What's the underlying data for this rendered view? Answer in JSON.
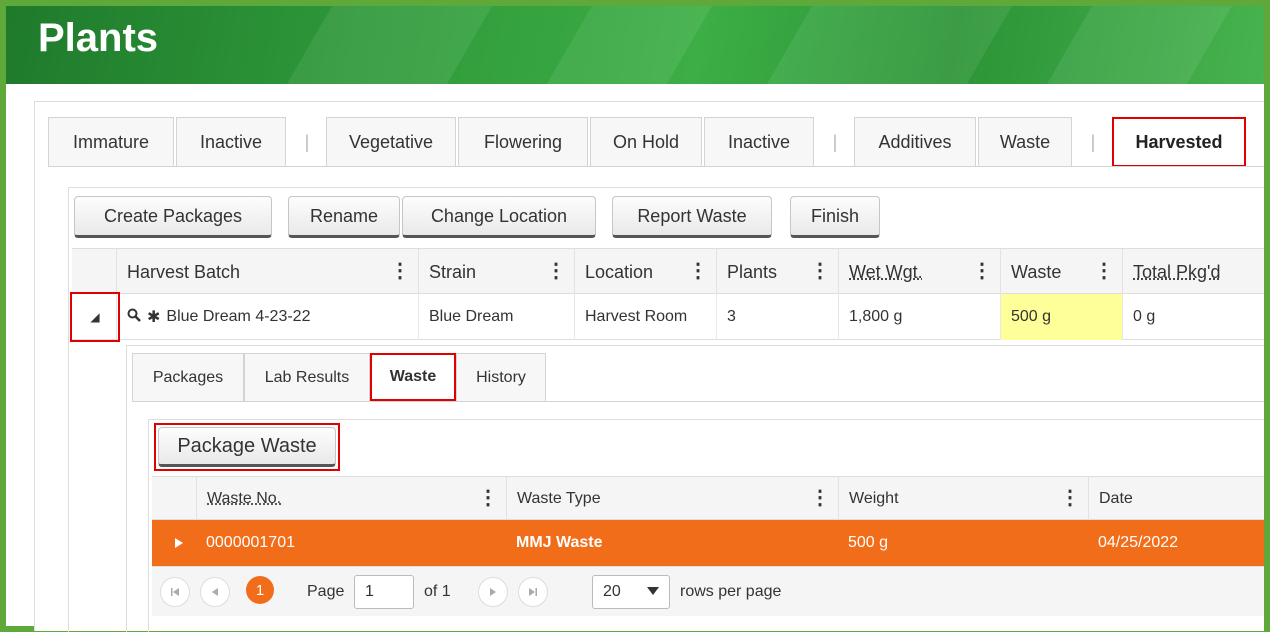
{
  "page": {
    "title": "Plants"
  },
  "main_tabs": [
    {
      "label": "Immature"
    },
    {
      "label": "Inactive"
    },
    {
      "label": "|"
    },
    {
      "label": "Vegetative"
    },
    {
      "label": "Flowering"
    },
    {
      "label": "On Hold"
    },
    {
      "label": "Inactive"
    },
    {
      "label": "|"
    },
    {
      "label": "Additives"
    },
    {
      "label": "Waste"
    },
    {
      "label": "|"
    },
    {
      "label": "Harvested"
    }
  ],
  "toolbar": {
    "create_packages": "Create Packages",
    "rename": "Rename",
    "change_location": "Change Location",
    "report_waste": "Report Waste",
    "finish": "Finish"
  },
  "harvest_grid": {
    "columns": [
      "Harvest Batch",
      "Strain",
      "Location",
      "Plants",
      "Wet Wgt.",
      "Waste",
      "Total Pkg'd"
    ],
    "row": {
      "harvest_batch": "Blue Dream 4-23-22",
      "strain": "Blue Dream",
      "location": "Harvest Room",
      "plants": "3",
      "wet_weight": "1,800 g",
      "waste": "500 g",
      "total_packaged": "0 g"
    },
    "highlight_color": "#ffff99"
  },
  "sub_tabs": [
    {
      "label": "Packages"
    },
    {
      "label": "Lab Results"
    },
    {
      "label": "Waste"
    },
    {
      "label": "History"
    }
  ],
  "waste_panel": {
    "package_waste_button": "Package Waste",
    "columns": [
      "Waste No.",
      "Waste Type",
      "Weight",
      "Date"
    ],
    "row": {
      "waste_no": "0000001701",
      "waste_type": "MMJ Waste",
      "weight": "500 g",
      "date": "04/25/2022"
    },
    "row_color": "#f26d1a"
  },
  "pager": {
    "current_page": "1",
    "page_label": "Page",
    "page_input": "1",
    "of_label": "of 1",
    "rows_value": "20",
    "rows_label": "rows per page"
  },
  "colors": {
    "frame": "#5fa83a",
    "highlight_border": "#e00000",
    "accent": "#f26d1a"
  }
}
